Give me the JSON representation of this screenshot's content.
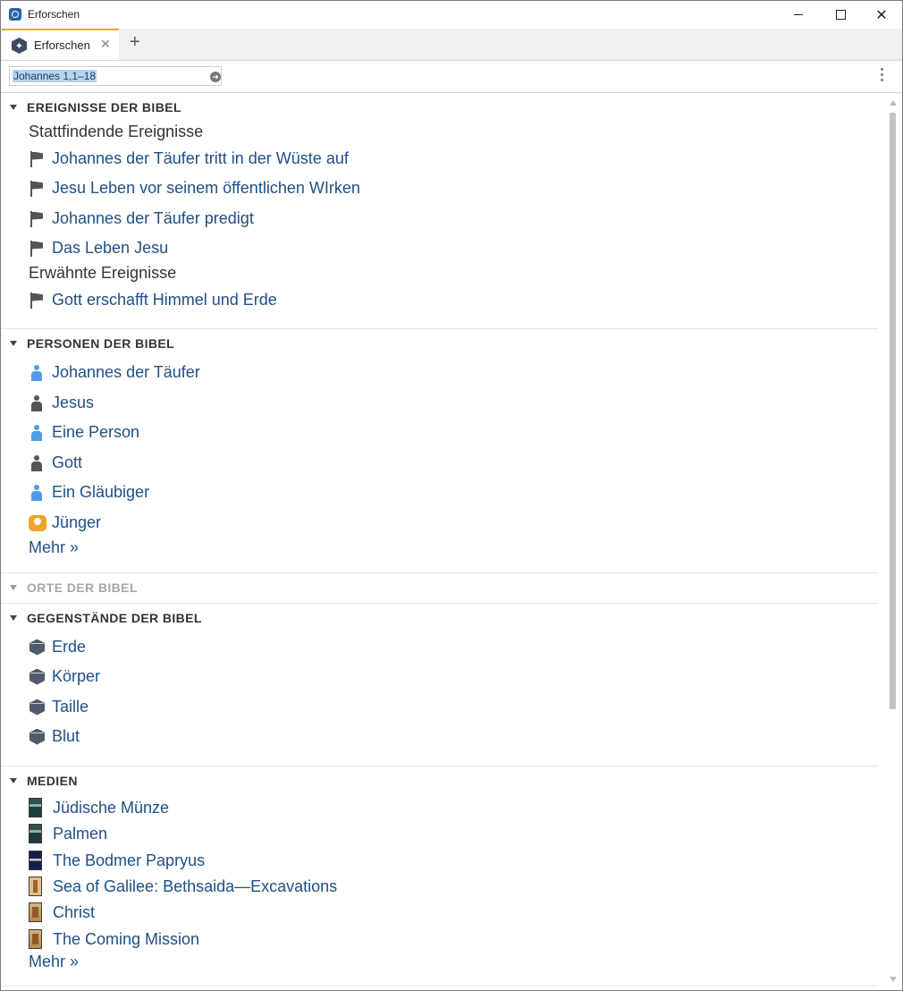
{
  "window": {
    "title": "Erforschen"
  },
  "tabs": [
    {
      "label": "Erforschen"
    }
  ],
  "toolbar": {
    "reference_value": "Johannes 1,1–18"
  },
  "events": {
    "heading": "EREIGNISSE DER BIBEL",
    "happening_label": "Stattfindende Ereignisse",
    "happening": [
      "Johannes der Täufer tritt in der Wüste auf",
      "Jesu Leben vor seinem öffentlichen WIrken",
      "Johannes der Täufer predigt",
      "Das Leben Jesu"
    ],
    "mentioned_label": "Erwähnte Ereignisse",
    "mentioned": [
      "Gott erschafft Himmel und Erde"
    ]
  },
  "people": {
    "heading": "PERSONEN DER BIBEL",
    "items": [
      {
        "label": "Johannes der Täufer",
        "icon": "person-icon",
        "color": "#4f9be6"
      },
      {
        "label": "Jesus",
        "icon": "person-icon",
        "color": "#555555"
      },
      {
        "label": "Eine Person",
        "icon": "person-icon",
        "color": "#4f9be6"
      },
      {
        "label": "Gott",
        "icon": "person-icon",
        "color": "#555555"
      },
      {
        "label": "Ein Gläubiger",
        "icon": "person-icon",
        "color": "#4f9be6"
      },
      {
        "label": "Jünger",
        "icon": "group-icon",
        "color": "#f0a22c"
      }
    ],
    "more": "Mehr »"
  },
  "places": {
    "heading": "ORTE DER BIBEL"
  },
  "things": {
    "heading": "GEGENSTÄNDE DER BIBEL",
    "items": [
      "Erde",
      "Körper",
      "Taille",
      "Blut"
    ]
  },
  "media": {
    "heading": "MEDIEN",
    "items": [
      {
        "label": "Jüdische Münze",
        "icon": "book-cover-icon"
      },
      {
        "label": "Palmen",
        "icon": "book-cover-icon"
      },
      {
        "label": "The Bodmer Papryus",
        "icon": "book-cover-icon"
      },
      {
        "label": "Sea of Galilee: Bethsaida—Excavations",
        "icon": "book-cover-icon"
      },
      {
        "label": "Christ",
        "icon": "book-cover-icon"
      },
      {
        "label": "The Coming Mission",
        "icon": "book-cover-icon"
      }
    ],
    "more": "Mehr »"
  },
  "colors": {
    "link": "#1f4f85",
    "accent_tab": "#e8a33d",
    "selection": "#b9d2ef"
  }
}
